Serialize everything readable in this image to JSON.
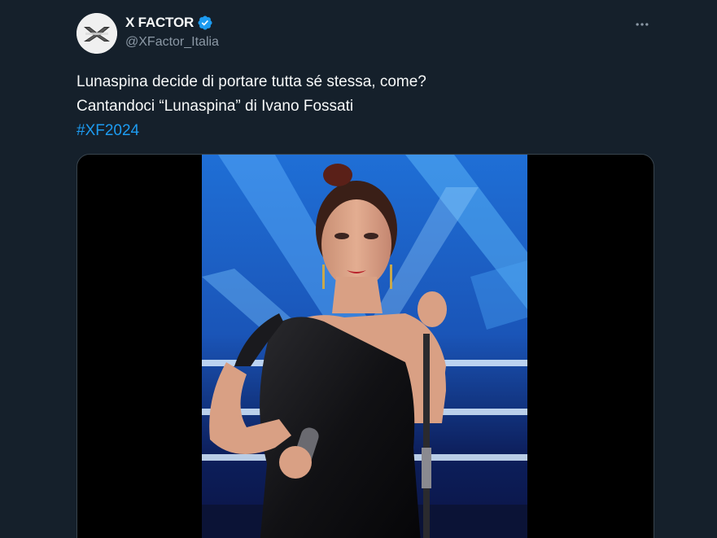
{
  "tweet": {
    "author": {
      "display_name": "X FACTOR",
      "handle": "@XFactor_Italia",
      "avatar_icon": "xfactor-logo-icon",
      "verified": true
    },
    "text_lines": [
      "Lunaspina decide di portare tutta sé stessa, come?",
      "Cantandoci “Lunaspina” di Ivano Fossati"
    ],
    "hashtag": "#XF2024",
    "more_icon": "more-options-icon",
    "media": {
      "type": "video",
      "icon": "video-frame"
    }
  },
  "colors": {
    "background": "#15202b",
    "text": "#f7f9f9",
    "secondary": "#8b98a5",
    "link": "#1d9bf0",
    "verified": "#1d9bf0"
  }
}
